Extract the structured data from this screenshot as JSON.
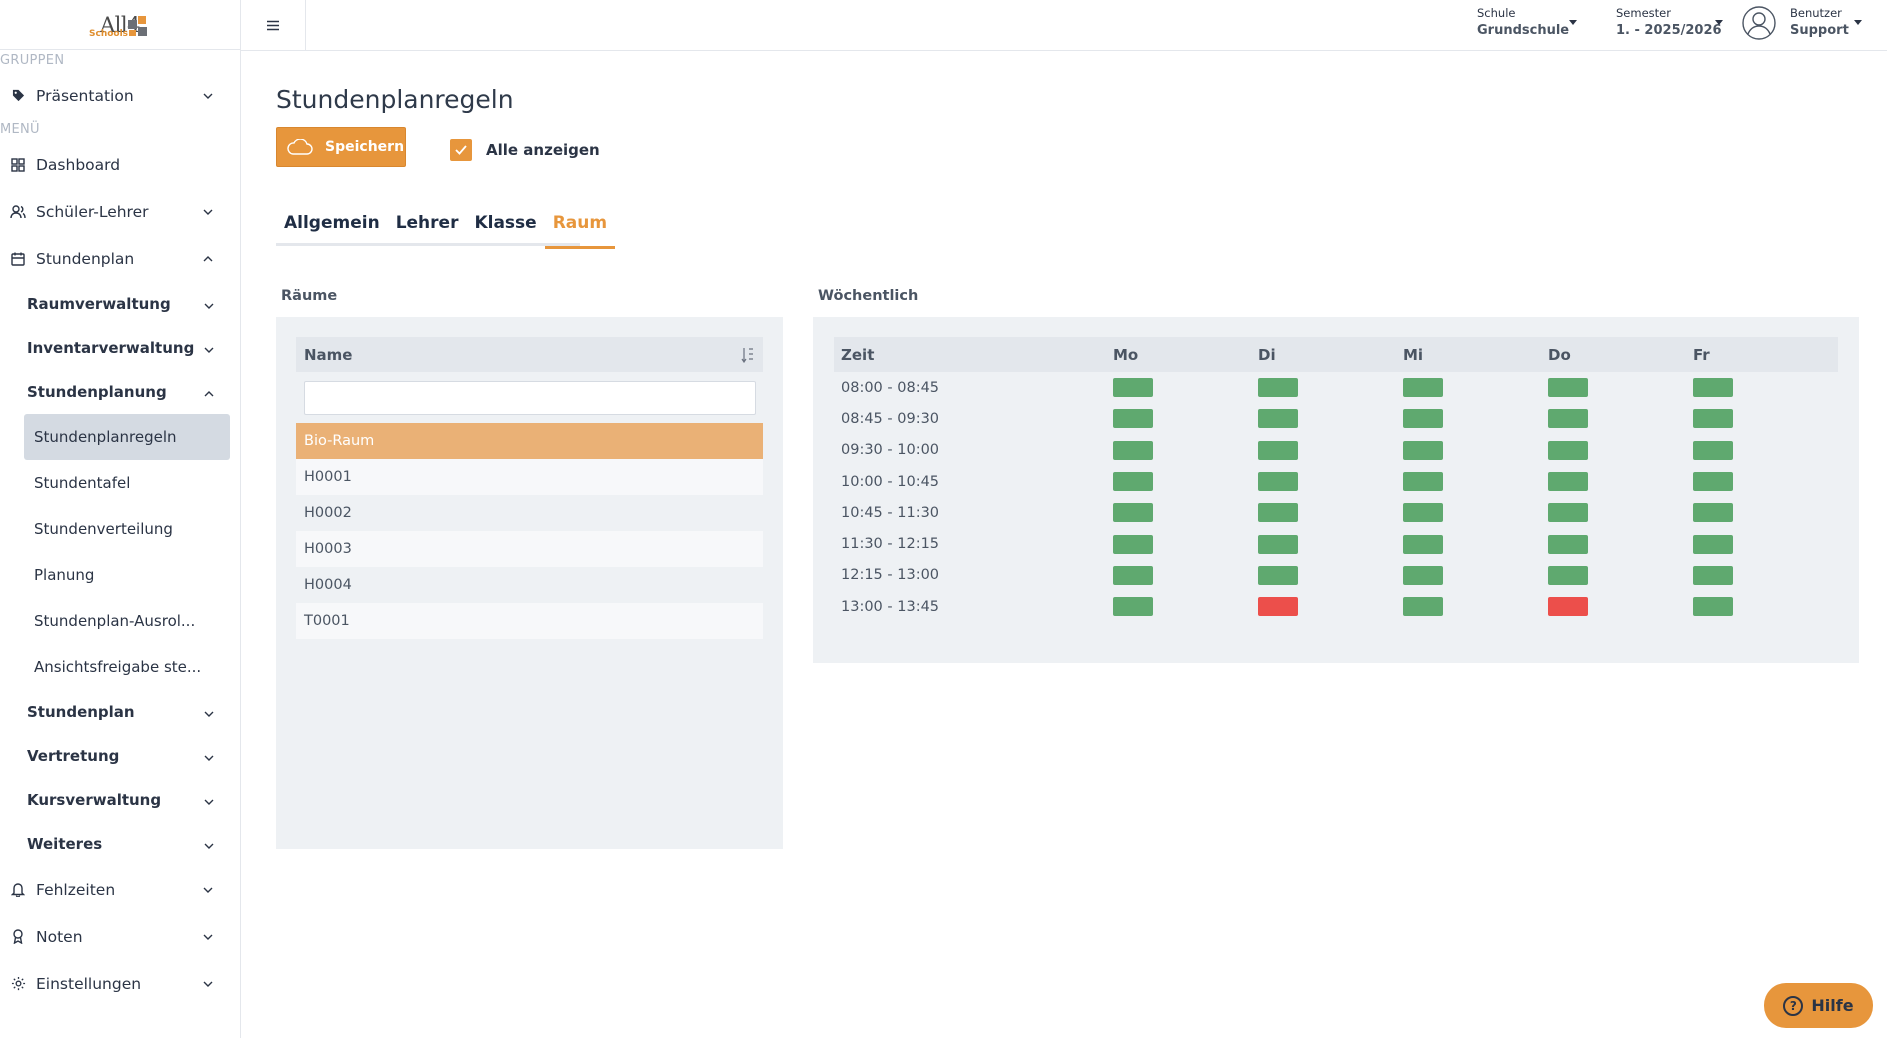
{
  "logo": {
    "text": "All4",
    "sub": "Schools"
  },
  "sidebar": {
    "groups_label": "GRUPPEN",
    "groups": [
      {
        "label": "Präsentation",
        "icon": "tag-icon"
      }
    ],
    "menu_label": "MENÜ",
    "items": [
      {
        "label": "Dashboard",
        "icon": "grid-icon"
      },
      {
        "label": "Schüler-Lehrer",
        "icon": "users-icon"
      },
      {
        "label": "Stundenplan",
        "icon": "calendar-icon"
      }
    ],
    "sub_items_top": [
      {
        "label": "Raumverwaltung"
      },
      {
        "label": "Inventarverwaltung"
      },
      {
        "label": "Stundenplanung"
      }
    ],
    "leaf_items": [
      {
        "label": "Stundenplanregeln",
        "active": true
      },
      {
        "label": "Stundentafel"
      },
      {
        "label": "Stundenverteilung"
      },
      {
        "label": "Planung"
      },
      {
        "label": "Stundenplan-Ausrol..."
      },
      {
        "label": "Ansichtsfreigabe ste..."
      }
    ],
    "sub_items_bottom": [
      {
        "label": "Stundenplan"
      },
      {
        "label": "Vertretung"
      },
      {
        "label": "Kursverwaltung"
      },
      {
        "label": "Weiteres"
      }
    ],
    "items_bottom": [
      {
        "label": "Fehlzeiten",
        "icon": "bell-icon"
      },
      {
        "label": "Noten",
        "icon": "award-icon"
      },
      {
        "label": "Einstellungen",
        "icon": "gear-icon"
      }
    ]
  },
  "topbar": {
    "school": {
      "label": "Schule",
      "value": "Grundschule"
    },
    "semester": {
      "label": "Semester",
      "value": "1. - 2025/2026"
    },
    "user": {
      "label": "Benutzer",
      "value": "Support"
    }
  },
  "page": {
    "title": "Stundenplanregeln",
    "save_label": "Speichern",
    "show_all_label": "Alle anzeigen",
    "show_all_checked": true,
    "tabs": [
      {
        "label": "Allgemein"
      },
      {
        "label": "Lehrer"
      },
      {
        "label": "Klasse"
      },
      {
        "label": "Raum",
        "active": true
      }
    ]
  },
  "rooms": {
    "section_label": "Räume",
    "column_name": "Name",
    "filter_value": "",
    "rows": [
      {
        "name": "Bio-Raum",
        "selected": true
      },
      {
        "name": "H0001"
      },
      {
        "name": "H0002"
      },
      {
        "name": "H0003"
      },
      {
        "name": "H0004"
      },
      {
        "name": "T0001"
      }
    ]
  },
  "weekly": {
    "section_label": "Wöchentlich",
    "columns": [
      "Zeit",
      "Mo",
      "Di",
      "Mi",
      "Do",
      "Fr"
    ],
    "colors": {
      "available": "#5fa96f",
      "blocked": "#ec4f4b"
    },
    "rows": [
      {
        "time": "08:00 - 08:45",
        "slots": [
          "available",
          "available",
          "available",
          "available",
          "available"
        ]
      },
      {
        "time": "08:45 - 09:30",
        "slots": [
          "available",
          "available",
          "available",
          "available",
          "available"
        ]
      },
      {
        "time": "09:30 - 10:00",
        "slots": [
          "available",
          "available",
          "available",
          "available",
          "available"
        ]
      },
      {
        "time": "10:00 - 10:45",
        "slots": [
          "available",
          "available",
          "available",
          "available",
          "available"
        ]
      },
      {
        "time": "10:45 - 11:30",
        "slots": [
          "available",
          "available",
          "available",
          "available",
          "available"
        ]
      },
      {
        "time": "11:30 - 12:15",
        "slots": [
          "available",
          "available",
          "available",
          "available",
          "available"
        ]
      },
      {
        "time": "12:15 - 13:00",
        "slots": [
          "available",
          "available",
          "available",
          "available",
          "available"
        ]
      },
      {
        "time": "13:00 - 13:45",
        "slots": [
          "available",
          "blocked",
          "available",
          "blocked",
          "available"
        ]
      }
    ]
  },
  "help": {
    "label": "Hilfe"
  },
  "colors": {
    "accent": "#e7963c",
    "selected_row": "#eab176",
    "active_nav": "#d4dae2"
  }
}
